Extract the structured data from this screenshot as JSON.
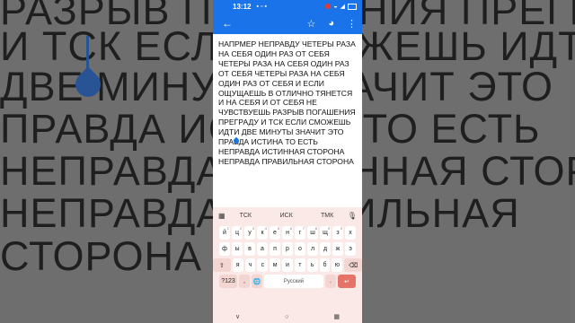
{
  "background": {
    "lines": [
      "РАЗРЫВ ПОГАШЕНИЯ ПРЕГРАДУ",
      "И ТСК ЕСЛИ СМОЖЕШЬ ИДТИ",
      "ДВЕ МИНУТЫ ЗНАЧИТ ЭТО",
      "ПРАВДА ИСТИНА ТО ЕСТЬ",
      "НЕПРАВДА ИСТИННАЯ СТОРОНА",
      "НЕПРАВДА ПРАВИЛЬНАЯ",
      "СТОРОНА"
    ]
  },
  "status": {
    "time": "13:12",
    "icons": [
      "chat-icon",
      "mail-icon",
      "photo-icon",
      "dot"
    ],
    "right_icons": [
      "wifi-icon",
      "signal-icon",
      "battery-icon"
    ]
  },
  "appbar": {
    "back_label": "←",
    "star_label": "☆",
    "palette_label": "◕",
    "more_label": "⋮"
  },
  "note": {
    "text": "НАПРМЕР НЕПРАВДУ ЧЕТЕРЫ РАЗА НА СЕБЯ ОДИН РАЗ ОТ СЕБЯ ЧЕТЕРЫ РАЗА НА СЕБЯ ОДИН РАЗ ОТ СЕБЯ ЧЕТЕРЫ РАЗА НА СЕБЯ ОДИН РАЗ ОТ СЕБЯ И ЕСЛИ ОЩУЩАЕШЬ В ОТЛИЧНО ТЯНЕТСЯ И НА СЕБЯ И ОТ СЕБЯ НЕ ЧУВСТВУЕШЬ РАЗРЫВ ПОГАШЕНИЯ ПРЕГРАДУ И ТСК ЕСЛИ СМОЖЕШЬ ИДТИ ДВЕ МИНУТЫ ЗНАЧИТ ЭТО ПРАВДА ИСТИНА ТО ЕСТЬ НЕПРАВДА ИСТИННАЯ СТОРОНА НЕПРАВДА ПРАВИЛЬНАЯ СТОРОНА"
  },
  "keyboard": {
    "suggestions": [
      "ТСК",
      "ИСК",
      "ТМК"
    ],
    "row1": [
      {
        "k": "й",
        "n": "1"
      },
      {
        "k": "ц",
        "n": "2"
      },
      {
        "k": "у",
        "n": "3"
      },
      {
        "k": "к",
        "n": "4"
      },
      {
        "k": "е",
        "n": "5"
      },
      {
        "k": "н",
        "n": "6"
      },
      {
        "k": "г",
        "n": "7"
      },
      {
        "k": "ш",
        "n": "8"
      },
      {
        "k": "щ",
        "n": "9"
      },
      {
        "k": "з",
        "n": "0"
      },
      {
        "k": "х",
        "n": ""
      }
    ],
    "row2": [
      "ф",
      "ы",
      "в",
      "а",
      "п",
      "р",
      "о",
      "л",
      "д",
      "ж",
      "э"
    ],
    "row3": [
      "я",
      "ч",
      "с",
      "м",
      "и",
      "т",
      "ь",
      "б",
      "ю"
    ],
    "shift_label": "⇧",
    "backspace_label": "⌫",
    "symbols_label": "?123",
    "comma_label": ",",
    "globe_label": "🌐",
    "space_label": "Русский",
    "period_label": ".",
    "enter_label": "↵"
  },
  "navbar": {
    "down_label": "∨",
    "home_label": "○",
    "recents_label": "▦"
  }
}
